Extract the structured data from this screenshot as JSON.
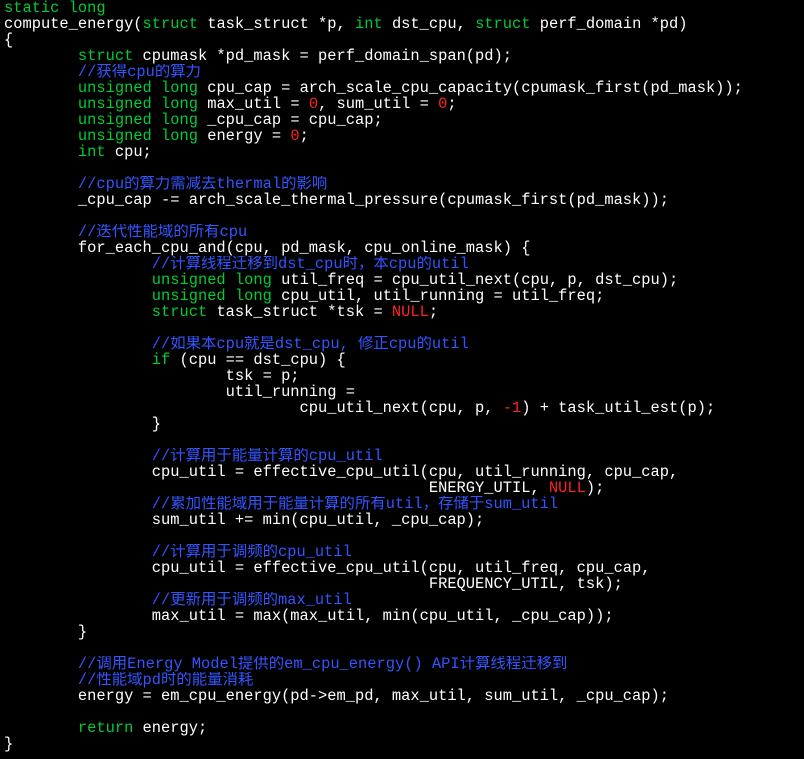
{
  "colors": {
    "background": "#000000",
    "plain": "#ffffff",
    "keyword": "#00cc33",
    "comment": "#3355ff",
    "constant": "#ff2222"
  },
  "lines": [
    [
      {
        "t": "static long",
        "c": "keyword"
      }
    ],
    [
      {
        "t": "compute_energy(",
        "c": "plain"
      },
      {
        "t": "struct",
        "c": "keyword"
      },
      {
        "t": " task_struct *p, ",
        "c": "plain"
      },
      {
        "t": "int",
        "c": "keyword"
      },
      {
        "t": " dst_cpu, ",
        "c": "plain"
      },
      {
        "t": "struct",
        "c": "keyword"
      },
      {
        "t": " perf_domain *pd)",
        "c": "plain"
      }
    ],
    [
      {
        "t": "{",
        "c": "plain"
      }
    ],
    [
      {
        "t": "        ",
        "c": "plain"
      },
      {
        "t": "struct",
        "c": "keyword"
      },
      {
        "t": " cpumask *pd_mask = perf_domain_span(pd);",
        "c": "plain"
      }
    ],
    [
      {
        "t": "        ",
        "c": "plain"
      },
      {
        "t": "//获得cpu的算力",
        "c": "comment"
      }
    ],
    [
      {
        "t": "        ",
        "c": "plain"
      },
      {
        "t": "unsigned long",
        "c": "keyword"
      },
      {
        "t": " cpu_cap = arch_scale_cpu_capacity(cpumask_first(pd_mask));",
        "c": "plain"
      }
    ],
    [
      {
        "t": "        ",
        "c": "plain"
      },
      {
        "t": "unsigned long",
        "c": "keyword"
      },
      {
        "t": " max_util = ",
        "c": "plain"
      },
      {
        "t": "0",
        "c": "constant"
      },
      {
        "t": ", sum_util = ",
        "c": "plain"
      },
      {
        "t": "0",
        "c": "constant"
      },
      {
        "t": ";",
        "c": "plain"
      }
    ],
    [
      {
        "t": "        ",
        "c": "plain"
      },
      {
        "t": "unsigned long",
        "c": "keyword"
      },
      {
        "t": " _cpu_cap = cpu_cap;",
        "c": "plain"
      }
    ],
    [
      {
        "t": "        ",
        "c": "plain"
      },
      {
        "t": "unsigned long",
        "c": "keyword"
      },
      {
        "t": " energy = ",
        "c": "plain"
      },
      {
        "t": "0",
        "c": "constant"
      },
      {
        "t": ";",
        "c": "plain"
      }
    ],
    [
      {
        "t": "        ",
        "c": "plain"
      },
      {
        "t": "int",
        "c": "keyword"
      },
      {
        "t": " cpu;",
        "c": "plain"
      }
    ],
    [],
    [
      {
        "t": "        ",
        "c": "plain"
      },
      {
        "t": "//cpu的算力需减去thermal的影响",
        "c": "comment"
      }
    ],
    [
      {
        "t": "        _cpu_cap -= arch_scale_thermal_pressure(cpumask_first(pd_mask));",
        "c": "plain"
      }
    ],
    [],
    [
      {
        "t": "        ",
        "c": "plain"
      },
      {
        "t": "//迭代性能域的所有cpu",
        "c": "comment"
      }
    ],
    [
      {
        "t": "        for_each_cpu_and(cpu, pd_mask, cpu_online_mask) {",
        "c": "plain"
      }
    ],
    [
      {
        "t": "                ",
        "c": "plain"
      },
      {
        "t": "//计算线程迁移到dst_cpu时，本cpu的util",
        "c": "comment"
      }
    ],
    [
      {
        "t": "                ",
        "c": "plain"
      },
      {
        "t": "unsigned long",
        "c": "keyword"
      },
      {
        "t": " util_freq = cpu_util_next(cpu, p, dst_cpu);",
        "c": "plain"
      }
    ],
    [
      {
        "t": "                ",
        "c": "plain"
      },
      {
        "t": "unsigned long",
        "c": "keyword"
      },
      {
        "t": " cpu_util, util_running = util_freq;",
        "c": "plain"
      }
    ],
    [
      {
        "t": "                ",
        "c": "plain"
      },
      {
        "t": "struct",
        "c": "keyword"
      },
      {
        "t": " task_struct *tsk = ",
        "c": "plain"
      },
      {
        "t": "NULL",
        "c": "constant"
      },
      {
        "t": ";",
        "c": "plain"
      }
    ],
    [],
    [
      {
        "t": "                ",
        "c": "plain"
      },
      {
        "t": "//如果本cpu就是dst_cpu, 修正cpu的util",
        "c": "comment"
      }
    ],
    [
      {
        "t": "                ",
        "c": "plain"
      },
      {
        "t": "if",
        "c": "keyword"
      },
      {
        "t": " (cpu == dst_cpu) {",
        "c": "plain"
      }
    ],
    [
      {
        "t": "                        tsk = p;",
        "c": "plain"
      }
    ],
    [
      {
        "t": "                        util_running =",
        "c": "plain"
      }
    ],
    [
      {
        "t": "                                cpu_util_next(cpu, p, ",
        "c": "plain"
      },
      {
        "t": "-1",
        "c": "constant"
      },
      {
        "t": ") + task_util_est(p);",
        "c": "plain"
      }
    ],
    [
      {
        "t": "                }",
        "c": "plain"
      }
    ],
    [],
    [
      {
        "t": "                ",
        "c": "plain"
      },
      {
        "t": "//计算用于能量计算的cpu_util",
        "c": "comment"
      }
    ],
    [
      {
        "t": "                cpu_util = effective_cpu_util(cpu, util_running, cpu_cap,",
        "c": "plain"
      }
    ],
    [
      {
        "t": "                                              ENERGY_UTIL, ",
        "c": "plain"
      },
      {
        "t": "NULL",
        "c": "constant"
      },
      {
        "t": ");",
        "c": "plain"
      }
    ],
    [
      {
        "t": "                ",
        "c": "plain"
      },
      {
        "t": "//累加性能域用于能量计算的所有util，存储于sum_util",
        "c": "comment"
      }
    ],
    [
      {
        "t": "                sum_util += min(cpu_util, _cpu_cap);",
        "c": "plain"
      }
    ],
    [],
    [
      {
        "t": "                ",
        "c": "plain"
      },
      {
        "t": "//计算用于调频的cpu_util",
        "c": "comment"
      }
    ],
    [
      {
        "t": "                cpu_util = effective_cpu_util(cpu, util_freq, cpu_cap,",
        "c": "plain"
      }
    ],
    [
      {
        "t": "                                              FREQUENCY_UTIL, tsk);",
        "c": "plain"
      }
    ],
    [
      {
        "t": "                ",
        "c": "plain"
      },
      {
        "t": "//更新用于调频的max_util",
        "c": "comment"
      }
    ],
    [
      {
        "t": "                max_util = max(max_util, min(cpu_util, _cpu_cap));",
        "c": "plain"
      }
    ],
    [
      {
        "t": "        }",
        "c": "plain"
      }
    ],
    [],
    [
      {
        "t": "        ",
        "c": "plain"
      },
      {
        "t": "//调用Energy Model提供的em_cpu_energy() API计算线程迁移到",
        "c": "comment"
      }
    ],
    [
      {
        "t": "        ",
        "c": "plain"
      },
      {
        "t": "//性能域pd时的能量消耗",
        "c": "comment"
      }
    ],
    [
      {
        "t": "        energy = em_cpu_energy(pd->em_pd, max_util, sum_util, _cpu_cap);",
        "c": "plain"
      }
    ],
    [],
    [
      {
        "t": "        ",
        "c": "plain"
      },
      {
        "t": "return",
        "c": "keyword"
      },
      {
        "t": " energy;",
        "c": "plain"
      }
    ],
    [
      {
        "t": "}",
        "c": "plain"
      }
    ]
  ]
}
